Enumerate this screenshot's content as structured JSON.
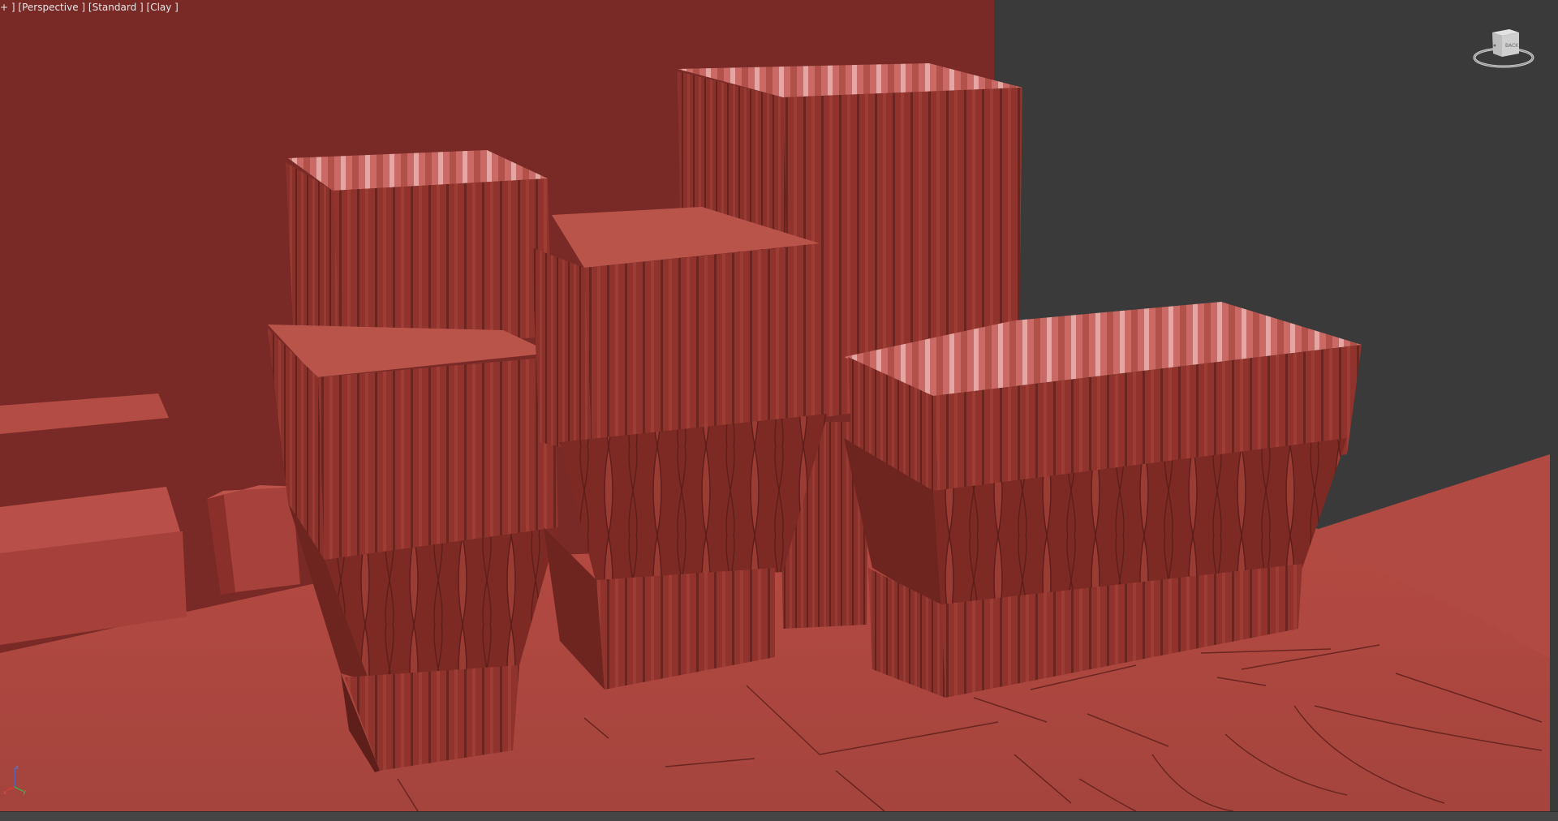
{
  "viewport": {
    "label_plus": "+ ]",
    "label_view": "[Perspective ]",
    "label_shading": "[Standard ]",
    "label_style": "[Clay ]",
    "background_color": "#3a3a3a",
    "clay_color": "#a8453d"
  },
  "viewcube": {
    "face_label": "BACK"
  },
  "axis": {
    "x_label": "x",
    "y_label": "y",
    "z_label": "z"
  }
}
